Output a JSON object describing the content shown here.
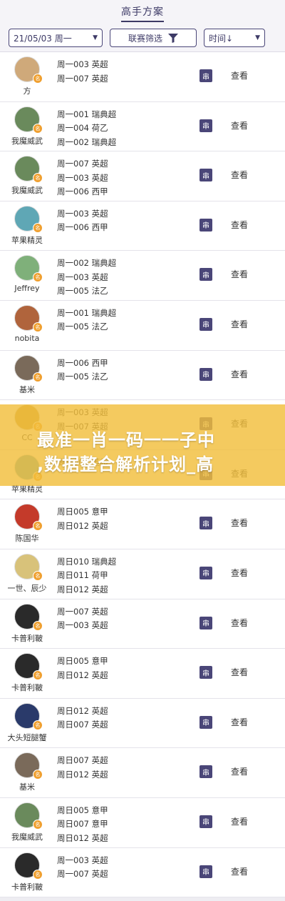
{
  "header": {
    "title": "高手方案"
  },
  "filters": {
    "date": "21/05/03 周一",
    "league": "联赛筛选",
    "sort": "时间↓"
  },
  "labels": {
    "chuan": "串",
    "view": "查看",
    "badge": "名"
  },
  "rows": [
    {
      "nick": "方",
      "avatar_color": "#cfa97a",
      "matches": [
        "周一003 英超",
        "周一007 英超"
      ]
    },
    {
      "nick": "我魔威武",
      "avatar_color": "#6a8a5c",
      "matches": [
        "周一001 瑞典超",
        "周一004 荷乙",
        "周一002 瑞典超"
      ]
    },
    {
      "nick": "我魔威武",
      "avatar_color": "#6a8a5c",
      "matches": [
        "周一007 英超",
        "周一003 英超",
        "周一006 西甲"
      ]
    },
    {
      "nick": "苹果精灵",
      "avatar_color": "#5fa7b5",
      "matches": [
        "周一003 英超",
        "周一006 西甲"
      ]
    },
    {
      "nick": "Jeffrey",
      "avatar_color": "#7fb07a",
      "matches": [
        "周一002 瑞典超",
        "周一003 英超",
        "周一005 法乙"
      ]
    },
    {
      "nick": "nobita",
      "avatar_color": "#b0643c",
      "matches": [
        "周一001 瑞典超",
        "周一005 法乙"
      ]
    },
    {
      "nick": "基米",
      "avatar_color": "#7a6a5a",
      "matches": [
        "周一006 西甲",
        "周一005 法乙"
      ]
    },
    {
      "nick": "CC",
      "avatar_color": "#c79a3a",
      "matches": [
        "周一003 英超",
        "周一007 英超"
      ]
    },
    {
      "nick": "苹果精灵",
      "avatar_color": "#5fa7b5",
      "matches": [
        "周一003 英超"
      ]
    },
    {
      "nick": "陈国华",
      "avatar_color": "#c43a2a",
      "matches": [
        "周日005 意甲",
        "周日012 英超"
      ]
    },
    {
      "nick": "一世、辰少",
      "avatar_color": "#d8c27a",
      "matches": [
        "周日010 瑞典超",
        "周日011 荷甲",
        "周日012 英超"
      ]
    },
    {
      "nick": "卡普利鞁",
      "avatar_color": "#2a2a2a",
      "matches": [
        "周一007 英超",
        "周一003 英超"
      ]
    },
    {
      "nick": "卡普利鞁",
      "avatar_color": "#2a2a2a",
      "matches": [
        "周日005 意甲",
        "周日012 英超"
      ]
    },
    {
      "nick": "大头短腿蟹",
      "avatar_color": "#2a3a6a",
      "matches": [
        "周日012 英超",
        "周日007 英超"
      ]
    },
    {
      "nick": "基米",
      "avatar_color": "#7a6a5a",
      "matches": [
        "周日007 英超",
        "周日012 英超"
      ]
    },
    {
      "nick": "我魔威武",
      "avatar_color": "#6a8a5c",
      "matches": [
        "周日005 意甲",
        "周日007 意甲",
        "周日012 英超"
      ]
    },
    {
      "nick": "卡普利鞁",
      "avatar_color": "#2a2a2a",
      "matches": [
        "周一003 英超",
        "周一007 英超"
      ]
    }
  ],
  "overlay": {
    "line1": "最准一肖一码一一子中",
    "line2": ",数据整合解析计划_高"
  }
}
